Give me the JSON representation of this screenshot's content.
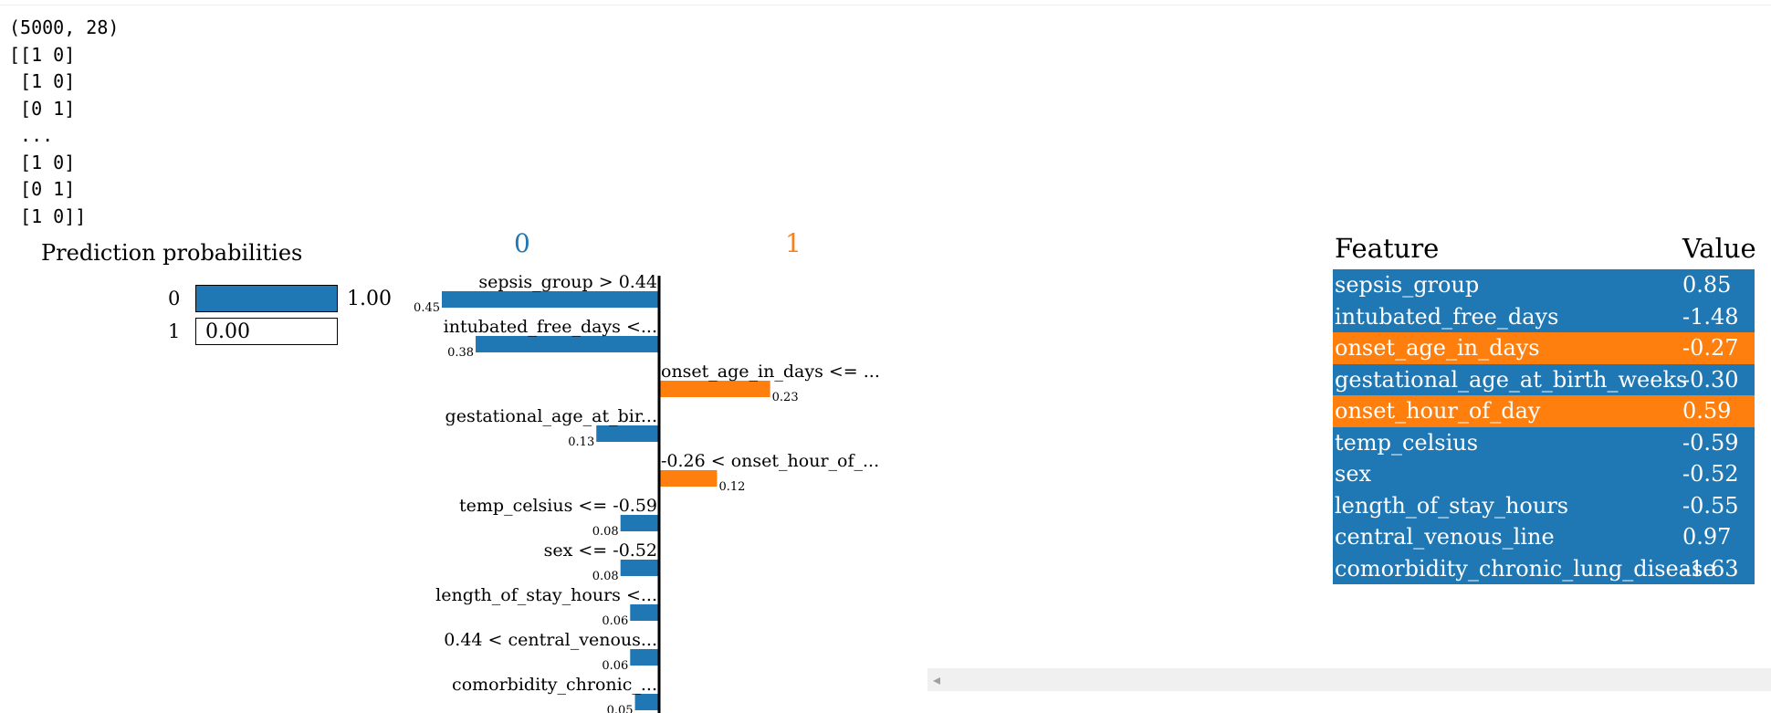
{
  "console_output": [
    "(5000, 28)",
    "[[1 0]",
    " [1 0]",
    " [0 1]",
    " ...",
    " [1 0]",
    " [0 1]",
    " [1 0]]"
  ],
  "prediction_probabilities": {
    "title": "Prediction probabilities",
    "rows": [
      {
        "class": "0",
        "value": 1.0,
        "label": "1.00",
        "color": "#1f77b4"
      },
      {
        "class": "1",
        "value": 0.0,
        "label": "0.00",
        "color": "#ff7f0e"
      }
    ]
  },
  "class_headers": [
    {
      "label": "0",
      "color": "#1f77b4"
    },
    {
      "label": "1",
      "color": "#ff7f0e"
    }
  ],
  "chart_data": {
    "type": "bar",
    "orientation": "horizontal-diverging",
    "series": [
      {
        "name": "0",
        "color": "#1f77b4"
      },
      {
        "name": "1",
        "color": "#ff7f0e"
      }
    ],
    "items": [
      {
        "label": "sepsis_group > 0.44",
        "value": 0.45,
        "value_label": "0.45",
        "class": "0"
      },
      {
        "label": "intubated_free_days <...",
        "value": 0.38,
        "value_label": "0.38",
        "class": "0"
      },
      {
        "label": "onset_age_in_days <= ...",
        "value": 0.23,
        "value_label": "0.23",
        "class": "1"
      },
      {
        "label": "gestational_age_at_bir...",
        "value": 0.13,
        "value_label": "0.13",
        "class": "0"
      },
      {
        "label": "-0.26 < onset_hour_of_...",
        "value": 0.12,
        "value_label": "0.12",
        "class": "1"
      },
      {
        "label": "temp_celsius <= -0.59",
        "value": 0.08,
        "value_label": "0.08",
        "class": "0"
      },
      {
        "label": "sex <= -0.52",
        "value": 0.08,
        "value_label": "0.08",
        "class": "0"
      },
      {
        "label": "length_of_stay_hours <...",
        "value": 0.06,
        "value_label": "0.06",
        "class": "0"
      },
      {
        "label": "0.44 < central_venous...",
        "value": 0.06,
        "value_label": "0.06",
        "class": "0"
      },
      {
        "label": "comorbidity_chronic_...",
        "value": 0.05,
        "value_label": "0.05",
        "class": "0"
      }
    ]
  },
  "feature_table": {
    "headers": {
      "feature": "Feature",
      "value": "Value"
    },
    "rows": [
      {
        "feature": "sepsis_group",
        "value": "0.85",
        "color": "#1f77b4"
      },
      {
        "feature": "intubated_free_days",
        "value": "-1.48",
        "color": "#1f77b4"
      },
      {
        "feature": "onset_age_in_days",
        "value": "-0.27",
        "color": "#ff7f0e"
      },
      {
        "feature": "gestational_age_at_birth_weeks",
        "value": "-0.30",
        "color": "#1f77b4"
      },
      {
        "feature": "onset_hour_of_day",
        "value": "0.59",
        "color": "#ff7f0e"
      },
      {
        "feature": "temp_celsius",
        "value": "-0.59",
        "color": "#1f77b4"
      },
      {
        "feature": "sex",
        "value": "-0.52",
        "color": "#1f77b4"
      },
      {
        "feature": "length_of_stay_hours",
        "value": "-0.55",
        "color": "#1f77b4"
      },
      {
        "feature": "central_venous_line",
        "value": "0.97",
        "color": "#1f77b4"
      },
      {
        "feature": "comorbidity_chronic_lung_disease",
        "value": "-1.63",
        "color": "#1f77b4"
      }
    ]
  },
  "scrollbar": {
    "left_arrow_icon": "chevron-left-icon"
  }
}
